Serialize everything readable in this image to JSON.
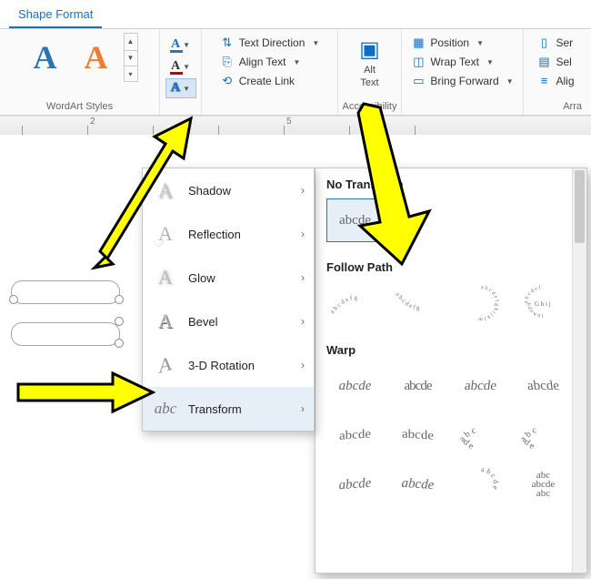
{
  "tab": {
    "label": "Shape Format"
  },
  "wordart": {
    "group_label": "WordArt Styles",
    "gallery": [
      "A",
      "A"
    ]
  },
  "textfx": {
    "fill_label": "A",
    "outline_label": "A",
    "effects_label": "A"
  },
  "textgroup": {
    "direction": "Text Direction",
    "align": "Align Text",
    "link": "Create Link"
  },
  "accessibility": {
    "btn_line1": "Alt",
    "btn_line2": "Text",
    "group_label": "Accessibility"
  },
  "arrange": {
    "position": "Position",
    "wrap": "Wrap Text",
    "forward": "Bring Forward",
    "send": "Ser",
    "select": "Sel",
    "align": "Alig",
    "group_label": "Arra"
  },
  "ruler": {
    "marks": [
      "",
      "2",
      "",
      "",
      "5"
    ]
  },
  "fxmenu": {
    "items": [
      {
        "label": "Shadow"
      },
      {
        "label": "Reflection"
      },
      {
        "label": "Glow"
      },
      {
        "label": "Bevel"
      },
      {
        "label": "3-D Rotation"
      },
      {
        "label": "Transform"
      }
    ]
  },
  "transform": {
    "sec_no": "No Transform",
    "no_sample": "abcde",
    "sec_follow": "Follow Path",
    "sec_warp": "Warp",
    "warp_samples": [
      "abcde",
      "abcde",
      "abcde",
      "abcde",
      "abcde",
      "abcde",
      "abcde",
      "abcde"
    ]
  }
}
